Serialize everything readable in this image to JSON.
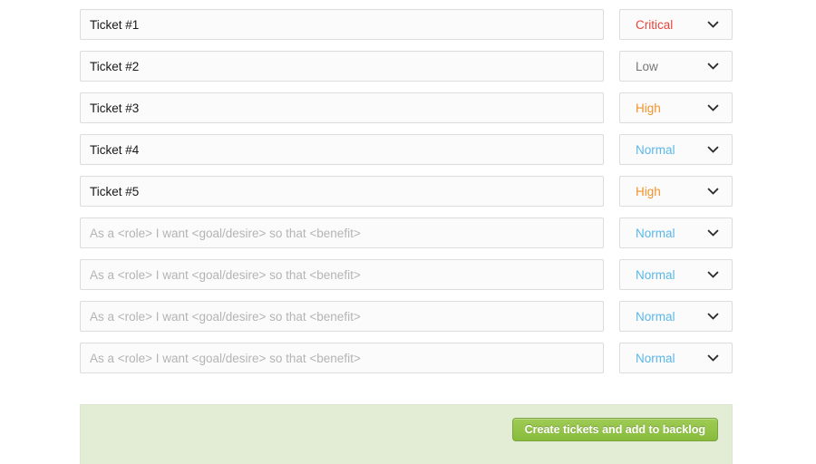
{
  "form": {
    "placeholder": "As a <role> I want <goal/desire> so that <benefit>",
    "chevron_icon": "chevron-down-icon",
    "rows": [
      {
        "title": "Ticket #1",
        "priority": "Critical",
        "priority_class": "p-critical"
      },
      {
        "title": "Ticket #2",
        "priority": "Low",
        "priority_class": "p-low"
      },
      {
        "title": "Ticket #3",
        "priority": "High",
        "priority_class": "p-high"
      },
      {
        "title": "Ticket #4",
        "priority": "Normal",
        "priority_class": "p-normal"
      },
      {
        "title": "Ticket #5",
        "priority": "High",
        "priority_class": "p-high"
      },
      {
        "title": "",
        "priority": "Normal",
        "priority_class": "p-normal"
      },
      {
        "title": "",
        "priority": "Normal",
        "priority_class": "p-normal"
      },
      {
        "title": "",
        "priority": "Normal",
        "priority_class": "p-normal"
      },
      {
        "title": "",
        "priority": "Normal",
        "priority_class": "p-normal"
      }
    ]
  },
  "footer": {
    "create_button_label": "Create tickets and add to backlog"
  },
  "colors": {
    "critical": "#e8453c",
    "high": "#f0932b",
    "normal": "#5bb7e8",
    "low": "#777777",
    "panel_bg": "#e3ecd5",
    "button_green": "#88bb3c"
  }
}
